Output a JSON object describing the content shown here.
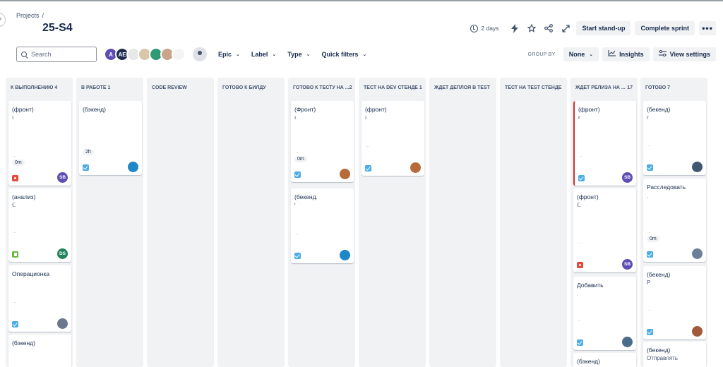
{
  "header": {
    "breadcrumb": "Projects",
    "breadcrumb_sep": "/",
    "title": "25-S4",
    "days_remaining": "2 days",
    "start_standup": "Start stand-up",
    "complete_sprint": "Complete sprint",
    "more_label": "•••",
    "icons": [
      "lightning-icon",
      "star-icon",
      "share-icon",
      "expand-icon"
    ]
  },
  "toolbar": {
    "search_placeholder": "Search",
    "avatars": [
      {
        "initials": "A",
        "color": "#5e4db2"
      },
      {
        "initials": "AE",
        "color": "#1d2b4f"
      },
      {
        "initials": "",
        "color": "#e8e8e8"
      },
      {
        "initials": "",
        "color": "#d8c7a8"
      },
      {
        "initials": "",
        "color": "#2f9b74"
      },
      {
        "initials": "",
        "color": "#c9a38a"
      },
      {
        "initials": "",
        "color": "#f4f4f4"
      }
    ],
    "filters": [
      "Epic",
      "Label",
      "Type",
      "Quick filters"
    ],
    "group_by_label": "GROUP BY",
    "group_by_value": "None",
    "insights": "Insights",
    "view_settings": "View settings"
  },
  "columns": [
    {
      "name": "К ВЫПОЛНЕНИЮ 4",
      "count": "",
      "cards": [
        {
          "title": "(фронт)",
          "sub": "ı",
          "estimate": "0m",
          "type": "bug",
          "assignee": "SB",
          "assignee_color": "#5e4db2"
        },
        {
          "title": "(анализ)",
          "sub": "ℂ",
          "estimate": "",
          "type": "story",
          "assignee": "DS",
          "assignee_color": "#1f845a"
        },
        {
          "title": "Операционка",
          "sub": "",
          "estimate": "",
          "type": "task",
          "assignee": "",
          "assignee_color": "#6b778c"
        },
        {
          "title": "(бэкенд)",
          "sub": "",
          "estimate": "",
          "type": "",
          "assignee": "",
          "assignee_color": ""
        }
      ]
    },
    {
      "name": "В РАБОТЕ 1",
      "count": "",
      "cards": [
        {
          "title": "(бэкенд)",
          "sub": "",
          "estimate": "2h",
          "type": "task",
          "assignee": "",
          "assignee_color": "#1e88c7"
        }
      ]
    },
    {
      "name": "CODE REVIEW",
      "count": "",
      "cards": []
    },
    {
      "name": "ГОТОВО К БИЛДУ",
      "count": "",
      "cards": []
    },
    {
      "name": "ГОТОВО К ТЕСТУ НА ...",
      "count": "2",
      "cards": [
        {
          "title": "(Фронт)",
          "sub": "ı",
          "estimate": "0m",
          "type": "task",
          "assignee": "",
          "assignee_color": "#b86b3a"
        },
        {
          "title": "(бекенд.",
          "sub": "ʳ",
          "estimate": "",
          "type": "task",
          "assignee": "",
          "assignee_color": "#1e88c7"
        }
      ]
    },
    {
      "name": "ТЕСТ НА DEV СТЕНДЕ 1",
      "count": "",
      "cards": [
        {
          "title": "(фронт)",
          "sub": "ı",
          "estimate": "",
          "type": "task",
          "assignee": "",
          "assignee_color": "#b86b3a"
        }
      ]
    },
    {
      "name": "ЖДЕТ ДЕПЛОЯ В TEST",
      "count": "",
      "cards": []
    },
    {
      "name": "ТЕСТ НА TEST СТЕНДЕ",
      "count": "",
      "cards": []
    },
    {
      "name": "ЖДЕТ РЕЛИЗА НА ...",
      "count": "17",
      "cards": [
        {
          "title": "(фронт)",
          "sub": "г",
          "estimate": "",
          "type": "task",
          "assignee": "SB",
          "assignee_color": "#5e4db2"
        },
        {
          "title": "(фронт)",
          "sub": "ℂ",
          "estimate": "",
          "type": "bug",
          "assignee": "SB",
          "assignee_color": "#5e4db2"
        },
        {
          "title": "Добавить",
          "sub": "ˌ",
          "estimate": "",
          "type": "task",
          "assignee": "",
          "assignee_color": "#4a6d8c"
        },
        {
          "title": "(бэкенд)",
          "sub": "",
          "estimate": "",
          "type": "",
          "assignee": "",
          "assignee_color": ""
        }
      ]
    },
    {
      "name": "ГОТОВО 7",
      "count": "",
      "cards": [
        {
          "title": "(бекенд)",
          "sub": "г",
          "estimate": "",
          "type": "task",
          "assignee": "",
          "assignee_color": "#3f5873"
        },
        {
          "title": "Расследовать",
          "sub": "ˌ",
          "estimate": "0m",
          "type": "task",
          "assignee": "",
          "assignee_color": "#6c7f99"
        },
        {
          "title": "(бекенд)",
          "sub": "Р",
          "estimate": "",
          "type": "task",
          "assignee": "",
          "assignee_color": "#a35a3c"
        },
        {
          "title": "(бекенд)",
          "sub": "Отправлять",
          "estimate": "",
          "type": "",
          "assignee": "",
          "assignee_color": ""
        }
      ]
    }
  ]
}
